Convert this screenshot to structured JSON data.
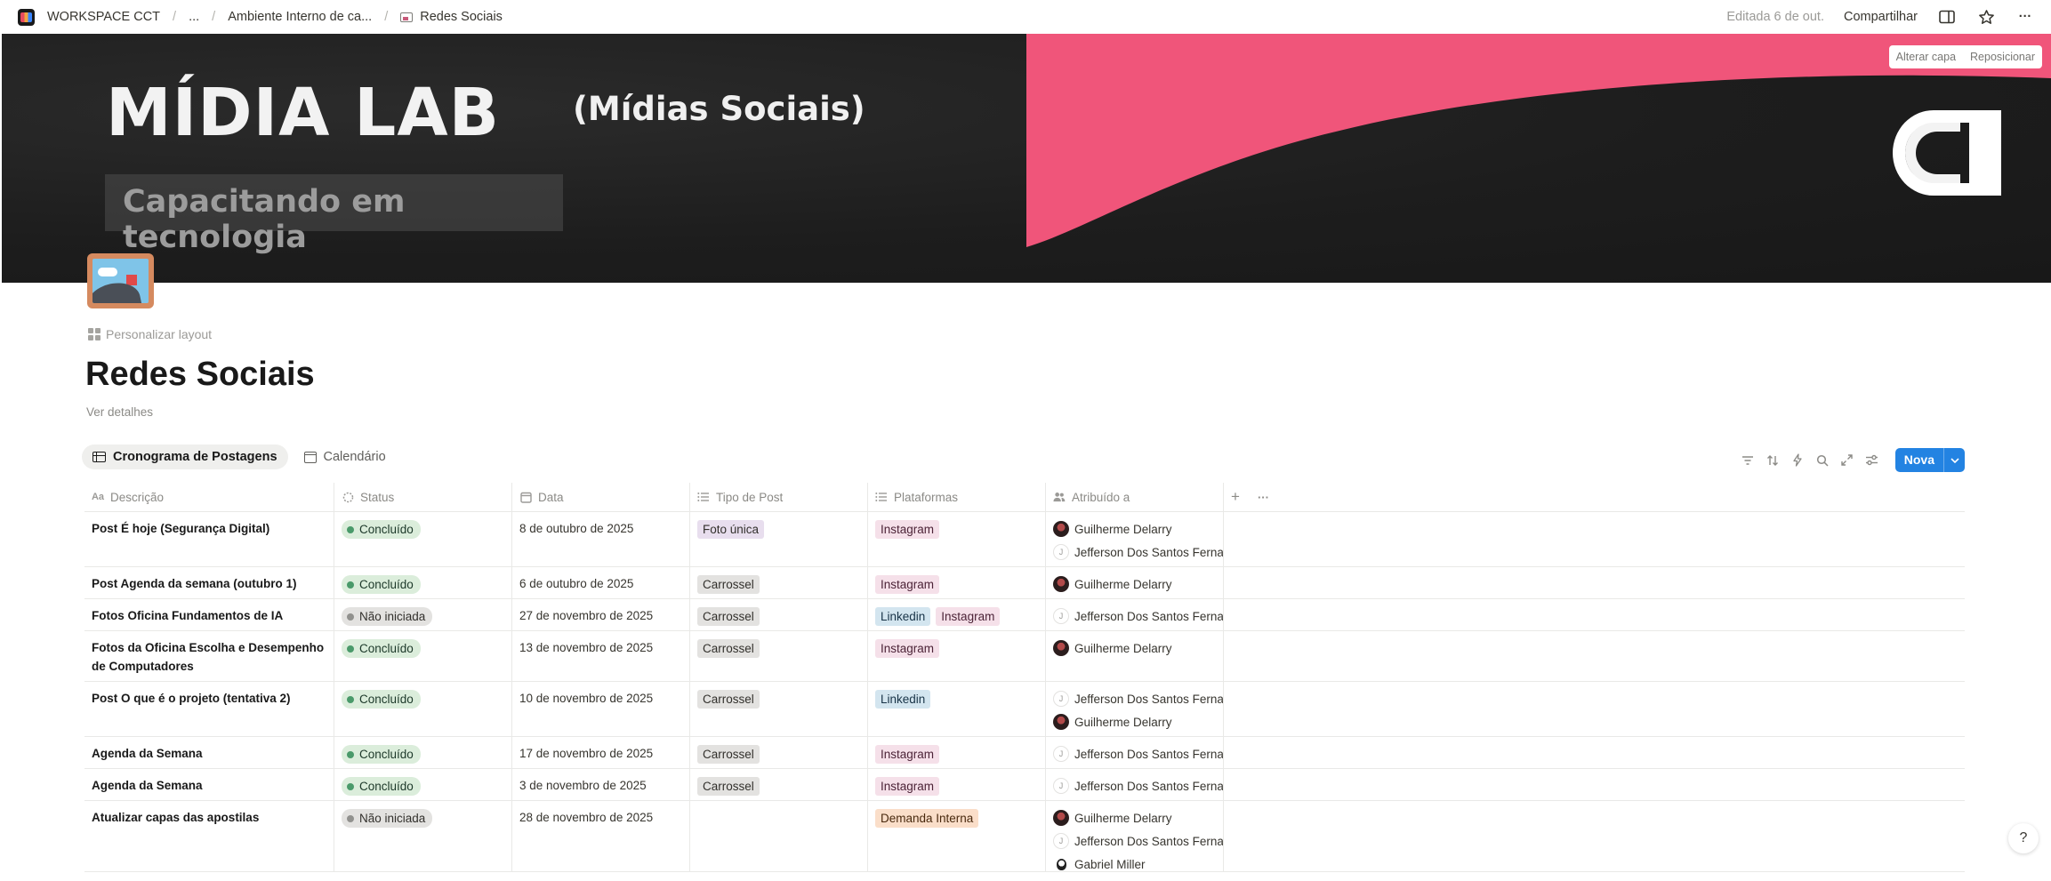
{
  "topbar": {
    "workspace": "WORKSPACE CCT",
    "ellipsis": "...",
    "parent": "Ambiente Interno de ca...",
    "current": "Redes Sociais",
    "edited": "Editada 6 de out.",
    "share": "Compartilhar",
    "more": "···"
  },
  "cover": {
    "title": "MÍDIA LAB",
    "subtitle": "(Mídias Sociais)",
    "tagline": "Capacitando em tecnologia",
    "change_label": "Alterar capa",
    "reposition_label": "Reposicionar",
    "accent": "#f0557a"
  },
  "page": {
    "personalize": "Personalizar layout",
    "title": "Redes Sociais",
    "details": "Ver detalhes"
  },
  "views": {
    "tabs": [
      "Cronograma de Postagens",
      "Calendário"
    ],
    "new_label": "Nova"
  },
  "table": {
    "columns": [
      "Descrição",
      "Status",
      "Data",
      "Tipo de Post",
      "Plataformas",
      "Atribuído a"
    ],
    "rows": [
      {
        "desc": "Post É hoje (Segurança Digital)",
        "status": "Concluído",
        "date": "8 de outubro de 2025",
        "type": "Foto única",
        "platforms": [
          "Instagram"
        ],
        "people": [
          "Guilherme Delarry",
          "Jefferson Dos Santos Ferna"
        ]
      },
      {
        "desc": "Post Agenda da semana (outubro 1)",
        "status": "Concluído",
        "date": "6 de outubro de 2025",
        "type": "Carrossel",
        "platforms": [
          "Instagram"
        ],
        "people": [
          "Guilherme Delarry"
        ]
      },
      {
        "desc": "Fotos Oficina Fundamentos de IA",
        "status": "Não iniciada",
        "date": "27 de novembro de 2025",
        "type": "Carrossel",
        "platforms": [
          "Linkedin",
          "Instagram"
        ],
        "people": [
          "Jefferson Dos Santos Ferna"
        ]
      },
      {
        "desc": "Fotos da Oficina Escolha e Desempenho de Computadores",
        "status": "Concluído",
        "date": "13 de novembro de 2025",
        "type": "Carrossel",
        "platforms": [
          "Instagram"
        ],
        "people": [
          "Guilherme Delarry"
        ]
      },
      {
        "desc": "Post O que é o projeto (tentativa 2)",
        "status": "Concluído",
        "date": "10 de novembro de 2025",
        "type": "Carrossel",
        "platforms": [
          "Linkedin"
        ],
        "people": [
          "Jefferson Dos Santos Ferna",
          "Guilherme Delarry"
        ]
      },
      {
        "desc": "Agenda da Semana",
        "status": "Concluído",
        "date": "17 de novembro de 2025",
        "type": "Carrossel",
        "platforms": [
          "Instagram"
        ],
        "people": [
          "Jefferson Dos Santos Ferna"
        ]
      },
      {
        "desc": "Agenda da Semana",
        "status": "Concluído",
        "date": "3 de novembro de 2025",
        "type": "Carrossel",
        "platforms": [
          "Instagram"
        ],
        "people": [
          "Jefferson Dos Santos Ferna"
        ]
      },
      {
        "desc": "Atualizar capas das apostilas",
        "status": "Não iniciada",
        "date": "28 de novembro de 2025",
        "type": "",
        "platforms": [
          "Demanda Interna"
        ],
        "people": [
          "Guilherme Delarry",
          "Jefferson Dos Santos Ferna",
          "Gabriel Miller"
        ]
      }
    ]
  },
  "colors": {
    "status_done_bg": "#dbeddb",
    "status_done_dot": "#4a9a6a",
    "status_todo_bg": "#e3e2e0",
    "status_todo_dot": "#91918e",
    "type_foto_bg": "#e8deee",
    "type_carrossel_bg": "#e3e2e0",
    "instagram_bg": "#f5e0e9",
    "instagram_fg": "#4c2337",
    "linkedin_bg": "#d3e5ef",
    "linkedin_fg": "#183347",
    "demanda_bg": "#fadec9",
    "demanda_fg": "#49290e",
    "accent_blue": "#2383e2"
  },
  "help": "?"
}
